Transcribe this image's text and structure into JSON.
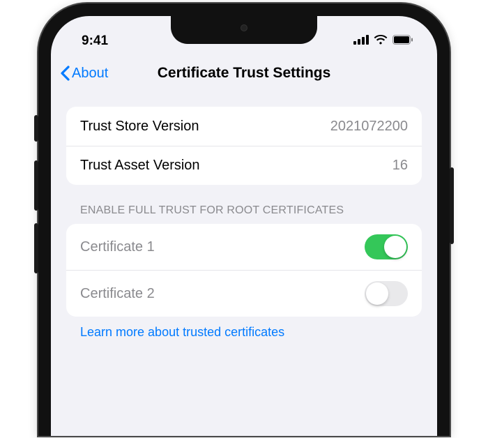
{
  "status": {
    "time": "9:41"
  },
  "nav": {
    "back": "About",
    "title": "Certificate Trust Settings"
  },
  "info_rows": [
    {
      "label": "Trust Store Version",
      "value": "2021072200"
    },
    {
      "label": "Trust Asset Version",
      "value": "16"
    }
  ],
  "cert_section": {
    "header": "ENABLE FULL TRUST FOR ROOT CERTIFICATES",
    "items": [
      {
        "label": "Certificate 1",
        "enabled": true
      },
      {
        "label": "Certificate 2",
        "enabled": false
      }
    ],
    "footer_link": "Learn more about trusted certificates"
  },
  "colors": {
    "accent": "#007aff",
    "toggle_on": "#34c759"
  }
}
